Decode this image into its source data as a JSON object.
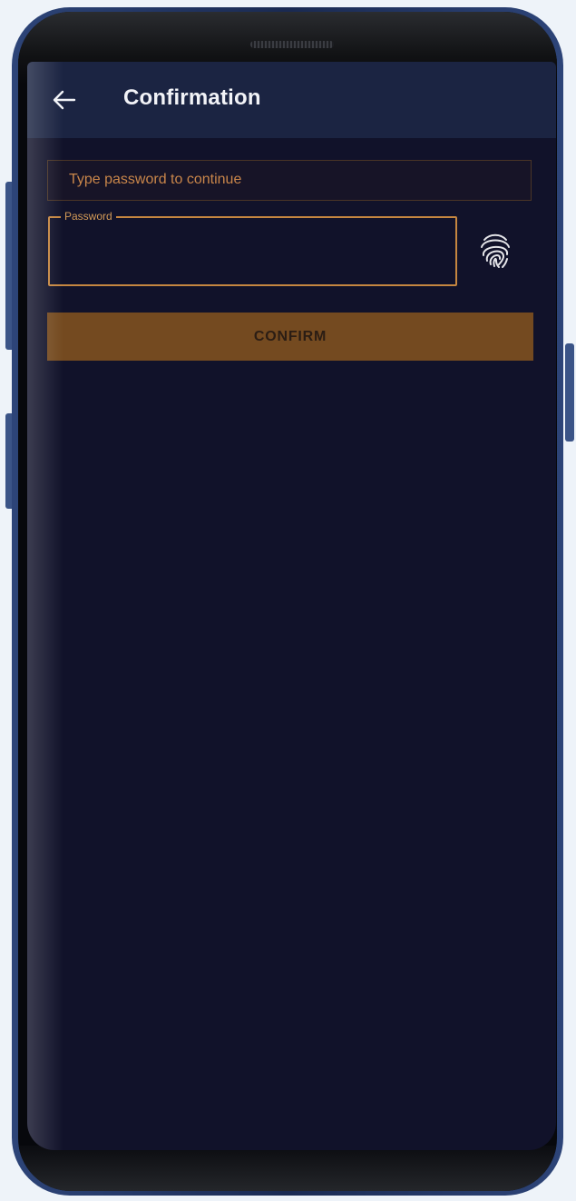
{
  "appbar": {
    "title": "Confirmation",
    "back_icon": "arrow-left-icon"
  },
  "hint": {
    "text": "Type password to continue"
  },
  "password_field": {
    "label": "Password",
    "value": "",
    "placeholder": ""
  },
  "fingerprint": {
    "icon": "fingerprint-icon"
  },
  "confirm_button": {
    "label": "CONFIRM"
  },
  "colors": {
    "screen_bg": "#11122a",
    "appbar_bg": "#1b2442",
    "accent": "#c58640",
    "button_bg": "#744a20"
  }
}
